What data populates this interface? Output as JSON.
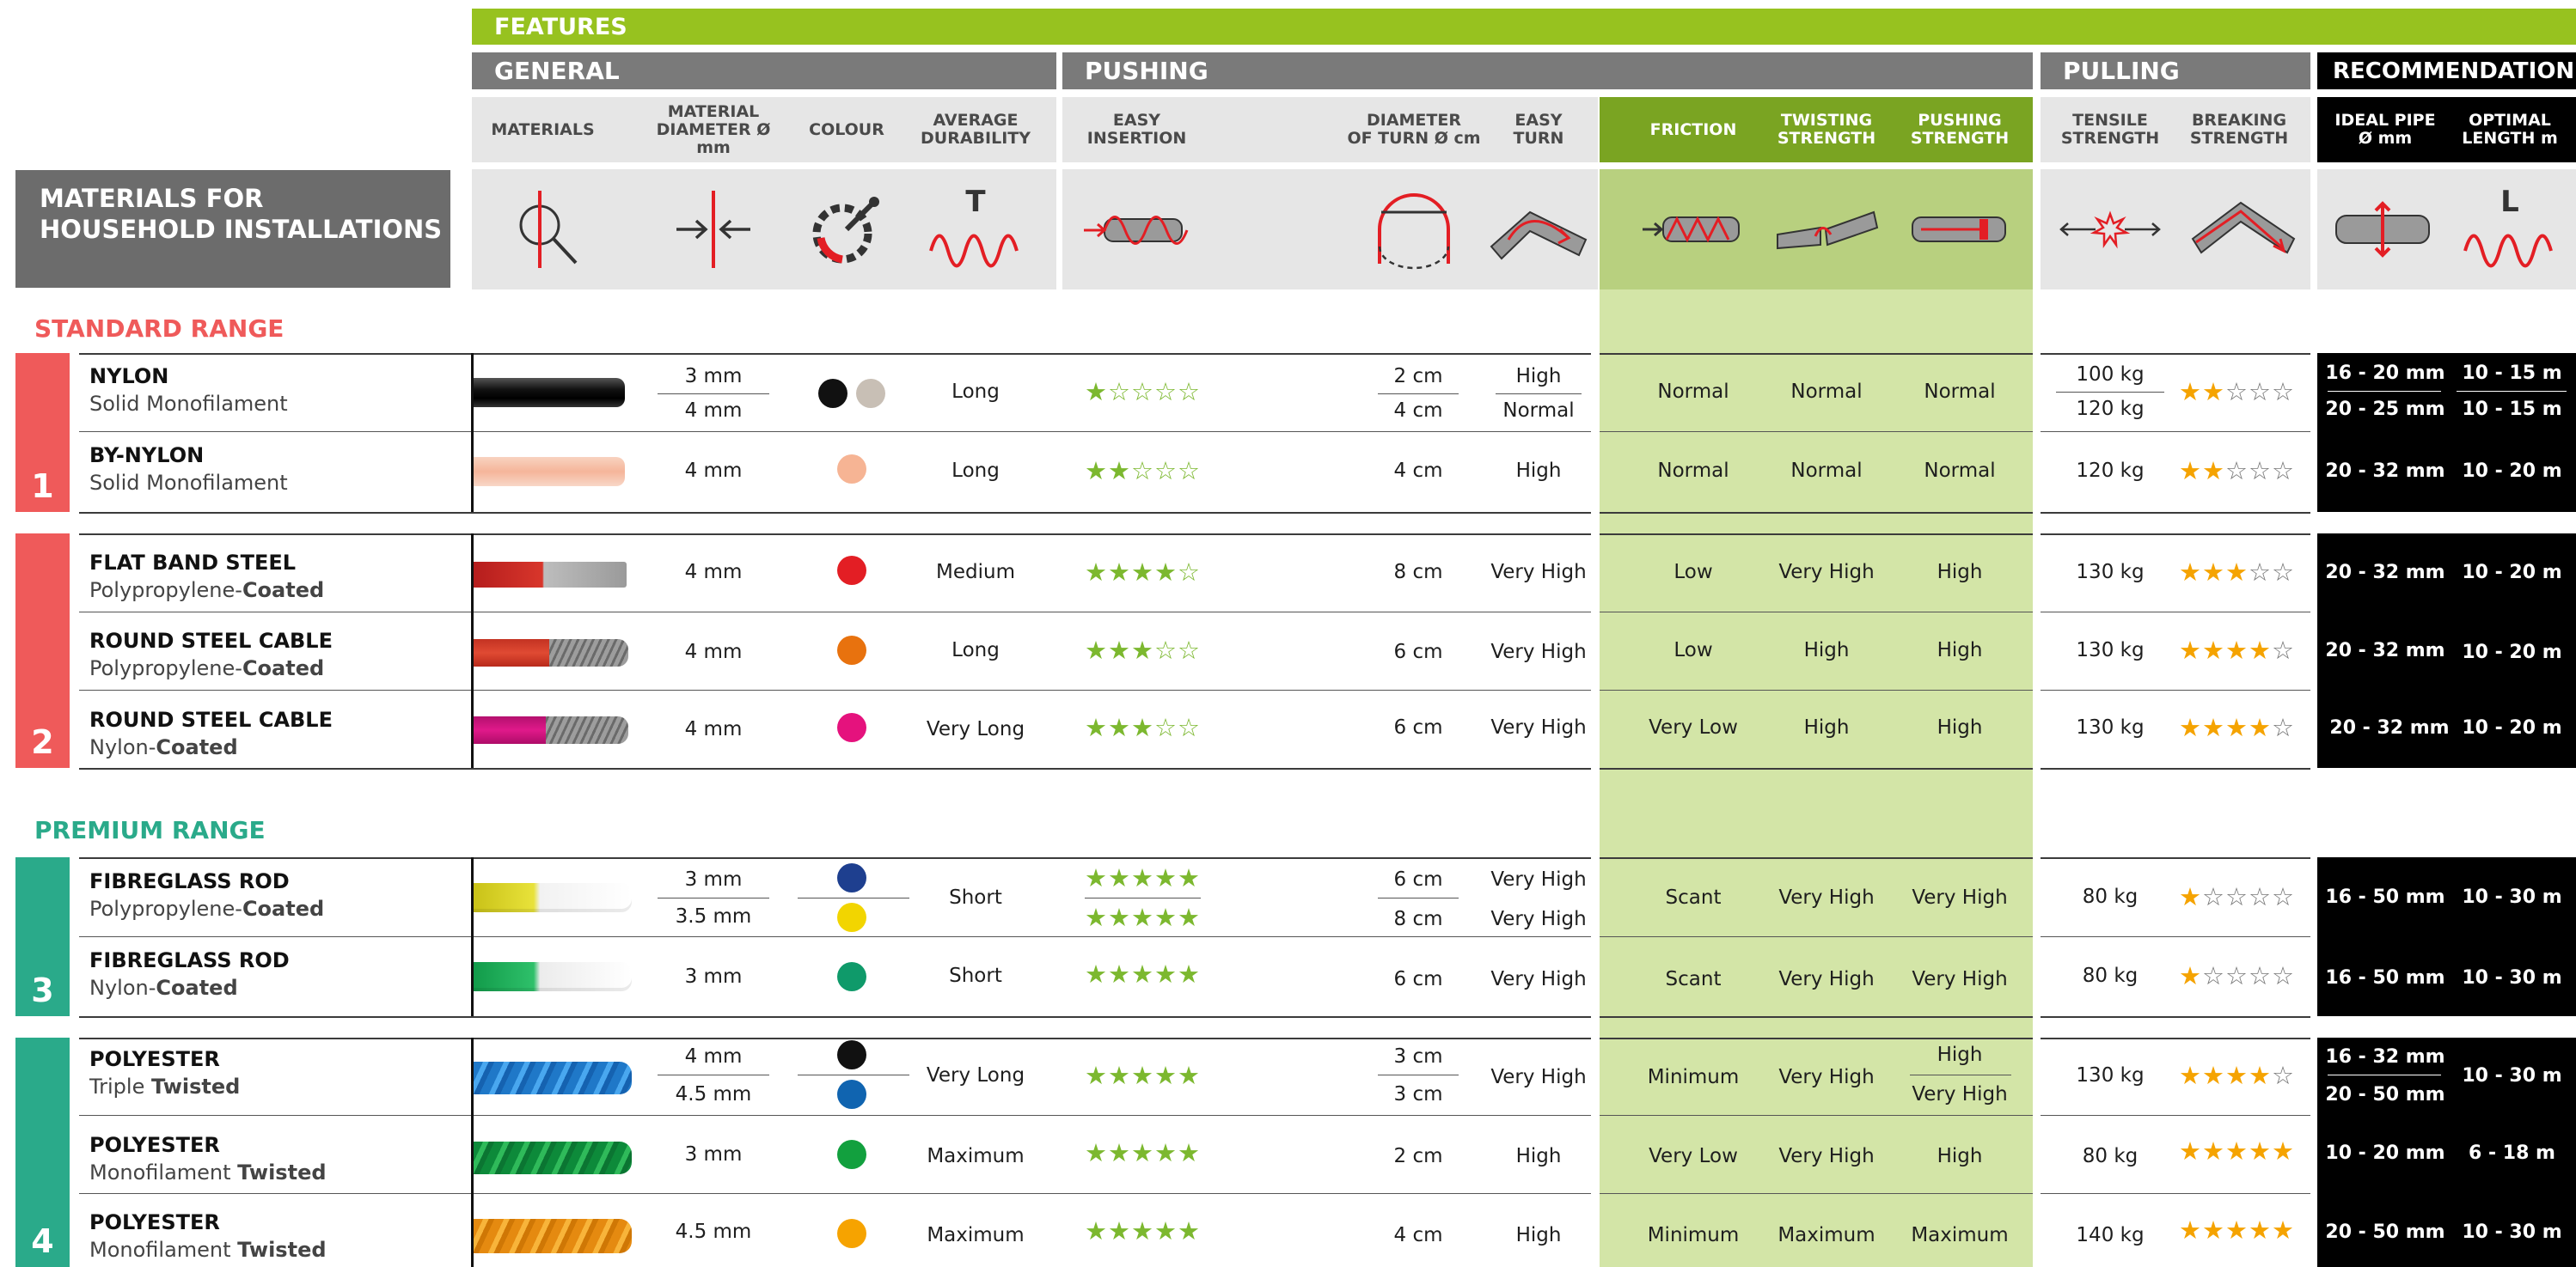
{
  "headers": {
    "features": "FEATURES",
    "general": "GENERAL",
    "pushing": "PUSHING",
    "pulling": "PULLING",
    "recommendations": "RECOMMENDATIONS",
    "title_line1": "MATERIALS FOR",
    "title_line2": "HOUSEHOLD INSTALLATIONS"
  },
  "columns": {
    "materials": "MATERIALS",
    "material_diameter": "MATERIAL\nDIAMETER Ø mm",
    "colour": "COLOUR",
    "average_durability": "AVERAGE\nDURABILITY",
    "easy_insertion": "EASY\nINSERTION",
    "diameter_of_turn": "DIAMETER\nOF TURN Ø cm",
    "easy_turn": "EASY\nTURN",
    "friction": "FRICTION",
    "twisting_strength": "TWISTING\nSTRENGTH",
    "pushing_strength": "PUSHING\nSTRENGTH",
    "tensile_strength": "TENSILE\nSTRENGTH",
    "breaking_strength": "BREAKING\nSTRENGTH",
    "ideal_pipe": "IDEAL PIPE\nØ mm",
    "optimal_length": "OPTIMAL\nLENGTH m"
  },
  "icons": {
    "durability_letter": "T",
    "length_letter": "L"
  },
  "ranges": {
    "standard": "STANDARD RANGE",
    "premium": "PREMIUM RANGE"
  },
  "groups": [
    "1",
    "2",
    "3",
    "4"
  ],
  "colors": {
    "green_bright": "#97c21f",
    "header_gray": "#7a7a7a",
    "title_gray": "#6c6c6c",
    "standard_red": "#ef5a5a",
    "premium_teal": "#2aaa8a",
    "pushing_green_header": "#7aa422",
    "pushing_green_band": "#d3e5a7",
    "recommend_black": "#000000"
  },
  "rows": {
    "nylon": {
      "name": "NYLON",
      "sub": "Solid Monofilament",
      "diam1": "3 mm",
      "diam2": "4 mm",
      "durability": "Long",
      "insertion_stars": 1,
      "turn1": "2 cm",
      "turn2": "4 cm",
      "easy1": "High",
      "easy2": "Normal",
      "friction": "Normal",
      "twisting": "Normal",
      "pushing": "Normal",
      "tensile1": "100 kg",
      "tensile2": "120 kg",
      "breaking_stars": 2,
      "pipe1": "16 - 20 mm",
      "pipe2": "20 - 25 mm",
      "len1": "10 - 15 m",
      "len2": "10 - 15 m"
    },
    "bynylon": {
      "name": "BY-NYLON",
      "sub": "Solid Monofilament",
      "diam": "4 mm",
      "durability": "Long",
      "insertion_stars": 2,
      "turn": "4 cm",
      "easy": "High",
      "friction": "Normal",
      "twisting": "Normal",
      "pushing": "Normal",
      "tensile": "120 kg",
      "breaking_stars": 2,
      "pipe": "20 - 32 mm",
      "len": "10 - 20 m"
    },
    "flatband": {
      "name": "FLAT BAND STEEL",
      "sub": "Polypropylene-",
      "sub_bold": "Coated",
      "diam": "4 mm",
      "durability": "Medium",
      "insertion_stars": 4,
      "turn": "8 cm",
      "easy": "Very High",
      "friction": "Low",
      "twisting": "Very High",
      "pushing": "High",
      "tensile": "130 kg",
      "breaking_stars": 3,
      "pipe": "20 - 32 mm",
      "len": "10 - 20 m"
    },
    "roundpp": {
      "name": "ROUND STEEL CABLE",
      "sub": "Polypropylene-",
      "sub_bold": "Coated",
      "diam": "4 mm",
      "durability": "Long",
      "insertion_stars": 3,
      "turn": "6 cm",
      "easy": "Very High",
      "friction": "Low",
      "twisting": "High",
      "pushing": "High",
      "tensile": "130 kg",
      "breaking_stars": 4,
      "pipe": "20 - 32 mm",
      "len": "10 - 20 m"
    },
    "roundny": {
      "name": "ROUND STEEL CABLE",
      "sub": "Nylon-",
      "sub_bold": "Coated",
      "diam": "4 mm",
      "durability": "Very Long",
      "insertion_stars": 3,
      "turn": "6 cm",
      "easy": "Very High",
      "friction": "Very Low",
      "twisting": "High",
      "pushing": "High",
      "tensile": "130 kg",
      "breaking_stars": 4,
      "pipe": "20 - 32 mm",
      "len": "10 - 20 m"
    },
    "fibrepp": {
      "name": "FIBREGLASS ROD",
      "sub": "Polypropylene-",
      "sub_bold": "Coated",
      "diam1": "3 mm",
      "diam2": "3.5 mm",
      "durability": "Short",
      "insertion_stars_1": 5,
      "insertion_stars_2": 5,
      "turn1": "6 cm",
      "turn2": "8 cm",
      "easy1": "Very High",
      "easy2": "Very High",
      "friction": "Scant",
      "twisting": "Very High",
      "pushing": "Very High",
      "tensile": "80 kg",
      "breaking_stars": 1,
      "pipe": "16 - 50 mm",
      "len": "10 - 30 m"
    },
    "fibreny": {
      "name": "FIBREGLASS ROD",
      "sub": "Nylon-",
      "sub_bold": "Coated",
      "diam": "3 mm",
      "durability": "Short",
      "insertion_stars": 5,
      "turn": "6 cm",
      "easy": "Very High",
      "friction": "Scant",
      "twisting": "Very High",
      "pushing": "Very High",
      "tensile": "80 kg",
      "breaking_stars": 1,
      "pipe": "16 - 50 mm",
      "len": "10 - 30 m"
    },
    "polytriple": {
      "name": "POLYESTER",
      "sub": "Triple ",
      "sub_bold": "Twisted",
      "diam1": "4 mm",
      "diam2": "4.5 mm",
      "durability": "Very Long",
      "insertion_stars": 5,
      "turn1": "3 cm",
      "turn2": "3 cm",
      "easy": "Very High",
      "friction": "Minimum",
      "twisting": "Very High",
      "pushing1": "High",
      "pushing2": "Very High",
      "tensile": "130 kg",
      "breaking_stars": 4,
      "pipe1": "16 - 32 mm",
      "pipe2": "20 - 50 mm",
      "len": "10 - 30 m"
    },
    "polymono1": {
      "name": "POLYESTER",
      "sub": "Monofilament ",
      "sub_bold": "Twisted",
      "diam": "3 mm",
      "durability": "Maximum",
      "insertion_stars": 5,
      "turn": "2 cm",
      "easy": "High",
      "friction": "Very Low",
      "twisting": "Very High",
      "pushing": "High",
      "tensile": "80 kg",
      "breaking_stars": 5,
      "pipe": "10 - 20 mm",
      "len": "6 - 18 m"
    },
    "polymono2": {
      "name": "POLYESTER",
      "sub": "Monofilament ",
      "sub_bold": "Twisted",
      "diam": "4.5 mm",
      "durability": "Maximum",
      "insertion_stars": 5,
      "turn": "4 cm",
      "easy": "High",
      "friction": "Minimum",
      "twisting": "Maximum",
      "pushing": "Maximum",
      "tensile": "140 kg",
      "breaking_stars": 5,
      "pipe": "20 - 50 mm",
      "len": "10 - 30 m"
    }
  }
}
